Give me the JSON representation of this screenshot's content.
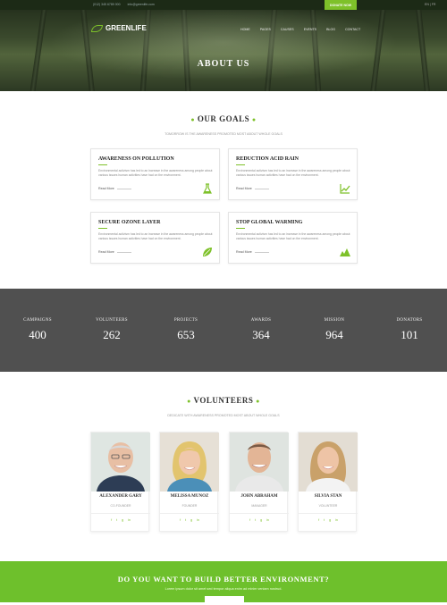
{
  "topbar": {
    "phone": "(012) 345 6789 000",
    "email": "info@greenlife.com",
    "donate_label": "DONATE NOW",
    "lang": "EN | FR"
  },
  "header": {
    "logo": "GREENLIFE",
    "nav": [
      "HOME",
      "PAGES",
      "CAUSES",
      "EVENTS",
      "BLOG",
      "CONTACT"
    ],
    "page_title": "ABOUT US"
  },
  "goals": {
    "title": "OUR GOALS",
    "subtitle": "TOMORROW IS THE AWARENESS PROMOTED MOST ABOUT WHOLE GOALS",
    "cards": [
      {
        "title": "AWARENESS ON POLLUTION",
        "text": "Environmental activism has led to an increase in the awareness among people about various issues human activities have had on the environment.",
        "more": "Read More",
        "icon": "flask-icon"
      },
      {
        "title": "REDUCTION ACID RAIN",
        "text": "Environmental activism has led to an increase in the awareness among people about various issues human activities have had on the environment.",
        "more": "Read More",
        "icon": "chart-icon"
      },
      {
        "title": "SECURE OZONE LAYER",
        "text": "Environmental activism has led to an increase in the awareness among people about various issues human activities have had on the environment.",
        "more": "Read More",
        "icon": "leaf-icon"
      },
      {
        "title": "STOP GLOBAL WARMING",
        "text": "Environmental activism has led to an increase in the awareness among people about various issues human activities have had on the environment.",
        "more": "Read More",
        "icon": "mountain-icon"
      }
    ]
  },
  "stats": [
    {
      "label": "CAMPAIGNS",
      "value": "400"
    },
    {
      "label": "VOLUNTEERS",
      "value": "262"
    },
    {
      "label": "PROJECTS",
      "value": "653"
    },
    {
      "label": "AWARDS",
      "value": "364"
    },
    {
      "label": "MISSION",
      "value": "964"
    },
    {
      "label": "DONATORS",
      "value": "101"
    }
  ],
  "volunteers": {
    "title": "VOLUNTEERS",
    "subtitle": "DEDICATE WITH AWARENESS PROMOTED MOST ABOUT WHOLE GOALS",
    "people": [
      {
        "name": "ALEXANDER GARY",
        "role": "CO-FOUNDER"
      },
      {
        "name": "MELISSA MUNOZ",
        "role": "FOUNDER"
      },
      {
        "name": "JOHN ABRAHAM",
        "role": "MANAGER"
      },
      {
        "name": "SILVIA STAN",
        "role": "VOLUNTEER"
      }
    ]
  },
  "cta": {
    "title": "DO YOU WANT TO BUILD BETTER ENVIRONMENT?",
    "text": "Lorem ipsum dolor sit amet sed tempor aliqua enim ad minim veniam nostrud."
  },
  "colors": {
    "accent": "#7ec12a",
    "stats_bg": "#505050"
  }
}
